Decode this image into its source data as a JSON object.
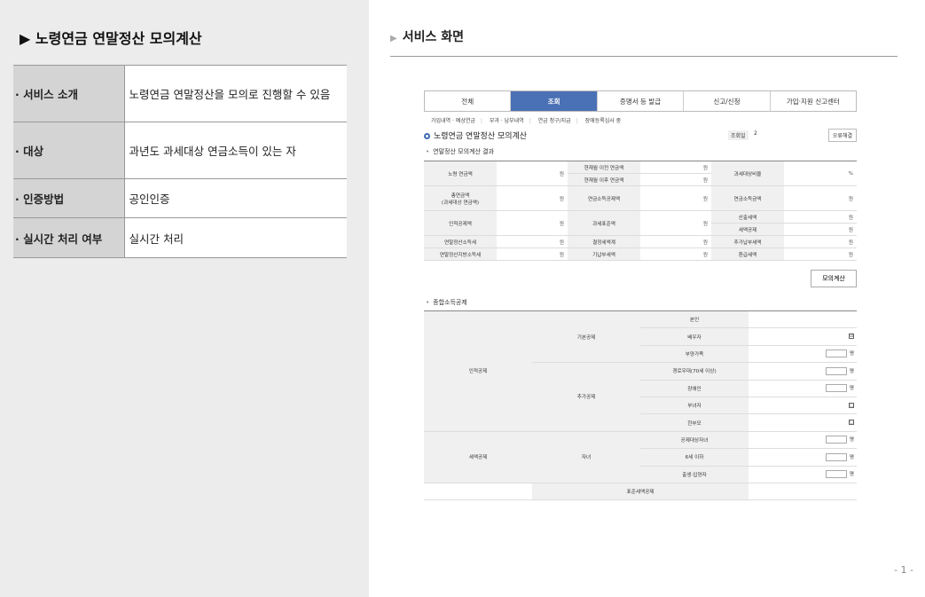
{
  "left": {
    "title": "노령연금 연말정산 모의계산",
    "rows": [
      {
        "key": "· 서비스 소개",
        "value": "노령연금 연말정산을 모의로 진행할 수 있음"
      },
      {
        "key": "· 대상",
        "value": "과년도 과세대상 연금소득이 있는 자"
      },
      {
        "key": "· 인증방법",
        "value": "공인인증"
      },
      {
        "key": "· 실시간 처리 여부",
        "value": "실시간 처리"
      }
    ]
  },
  "right": {
    "title": "서비스 화면",
    "page_number": "- 1 -"
  },
  "screen": {
    "tabs": [
      "전체",
      "조회",
      "증명서 등 발급",
      "신고/신청",
      "가입·지원 신고센터"
    ],
    "subtabs": [
      "가입내역 · 예상연금",
      "부과 · 납부내역",
      "연금 청구/지급",
      "장애등록심사 중"
    ],
    "title": "노령연금 연말정산 모의계산",
    "query_label": "조회일",
    "query_value": "2",
    "error_button": "오류해결",
    "section1": "연말정산 모의계산 결과",
    "unit_won": "원",
    "unit_pct": "%",
    "result_rows": [
      [
        "노령 연금액",
        "현재월 이전 연금액",
        "과세대상비율"
      ],
      [
        "",
        "현재월 이후 연금액",
        ""
      ],
      [
        "총연금액\n(과세대상 연금액)",
        "연금소득공제액",
        "연금소득금액"
      ],
      [
        "인적공제액",
        "과세표준액",
        "산출세액"
      ],
      [
        "",
        "",
        "세액공제"
      ],
      [
        "연말정산소득세",
        "결정세액계",
        "추가납부세액"
      ],
      [
        "연말정산지방소득세",
        "기납부세액",
        "환급세액"
      ]
    ],
    "simulate_button": "모의계산",
    "section2": "종합소득공제",
    "deduction": {
      "personal": "인적공제",
      "basic": "기본공제",
      "additional": "추가공제",
      "tax_credit": "세액공제",
      "child": "자녀",
      "standard": "표준세액공제",
      "items": [
        "본인",
        "배우자",
        "부양가족",
        "경로우대(70세 이상)",
        "장애인",
        "부녀자",
        "한부모",
        "공제대상자녀",
        "6세 이하",
        "출생·입양자"
      ],
      "unit_person": "명",
      "check_mark": "☑",
      "empty_box": "□"
    }
  }
}
